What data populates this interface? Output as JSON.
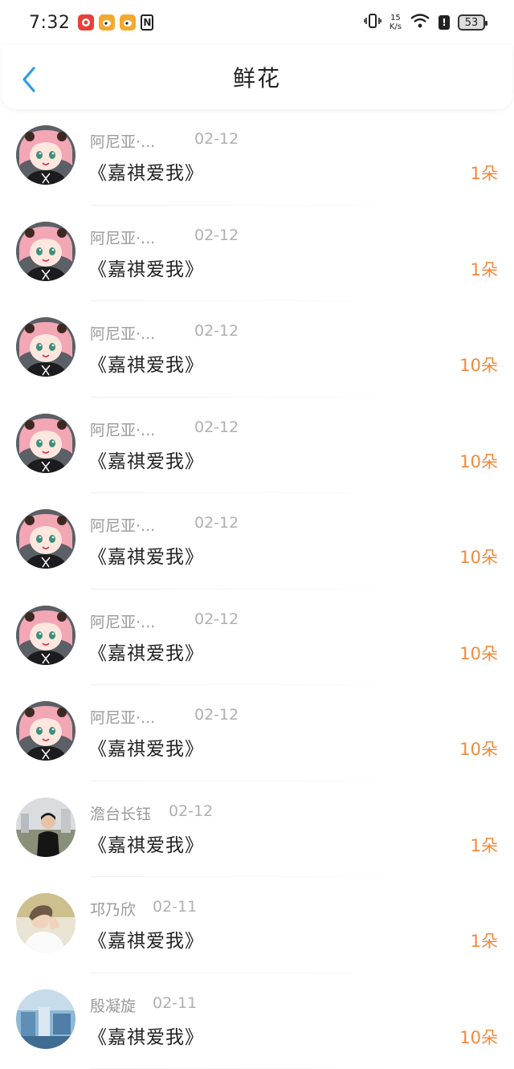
{
  "status": {
    "time": "7:32",
    "speed_top": "15",
    "speed_bottom": "K/s",
    "battery": "53"
  },
  "header": {
    "title": "鲜花"
  },
  "items": [
    {
      "name": "阿尼亚·...",
      "date": "02-12",
      "gift": "《嘉祺爱我》",
      "count": "1朵",
      "avatar": "anime"
    },
    {
      "name": "阿尼亚·...",
      "date": "02-12",
      "gift": "《嘉祺爱我》",
      "count": "1朵",
      "avatar": "anime"
    },
    {
      "name": "阿尼亚·...",
      "date": "02-12",
      "gift": "《嘉祺爱我》",
      "count": "10朵",
      "avatar": "anime"
    },
    {
      "name": "阿尼亚·...",
      "date": "02-12",
      "gift": "《嘉祺爱我》",
      "count": "10朵",
      "avatar": "anime"
    },
    {
      "name": "阿尼亚·...",
      "date": "02-12",
      "gift": "《嘉祺爱我》",
      "count": "10朵",
      "avatar": "anime"
    },
    {
      "name": "阿尼亚·...",
      "date": "02-12",
      "gift": "《嘉祺爱我》",
      "count": "10朵",
      "avatar": "anime"
    },
    {
      "name": "阿尼亚·...",
      "date": "02-12",
      "gift": "《嘉祺爱我》",
      "count": "10朵",
      "avatar": "anime"
    },
    {
      "name": "澹台长钰",
      "date": "02-12",
      "gift": "《嘉祺爱我》",
      "count": "1朵",
      "avatar": "person-street"
    },
    {
      "name": "邛乃欣",
      "date": "02-11",
      "gift": "《嘉祺爱我》",
      "count": "1朵",
      "avatar": "person-light"
    },
    {
      "name": "殷凝旋",
      "date": "02-11",
      "gift": "《嘉祺爱我》",
      "count": "10朵",
      "avatar": "blue-scene"
    }
  ],
  "colors": {
    "accent_back": "#2f9be8",
    "count_orange": "#f08a3c"
  }
}
